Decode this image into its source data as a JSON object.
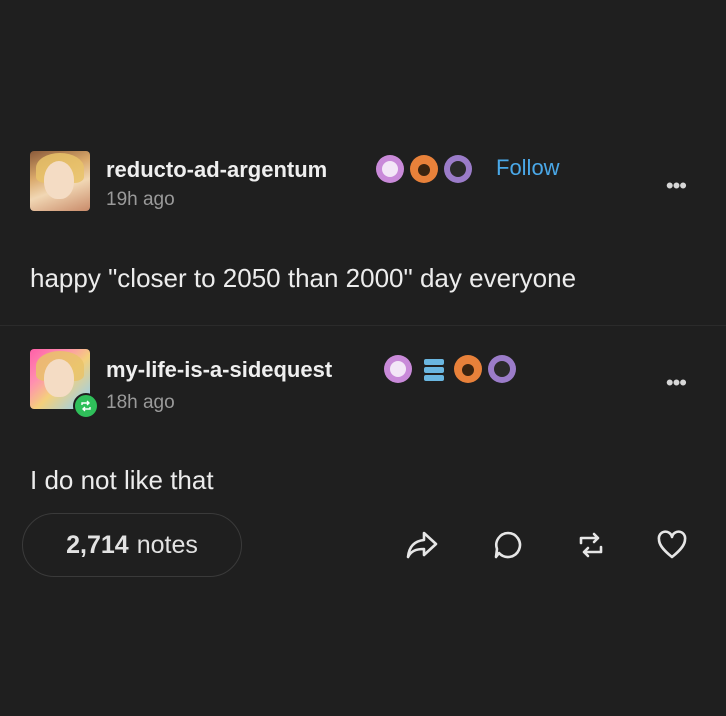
{
  "posts": [
    {
      "username": "reducto-ad-argentum",
      "time": "19h ago",
      "follow_label": "Follow",
      "more_label": "•••",
      "content": "happy \"closer to 2050 than 2000\" day everyone"
    },
    {
      "username": "my-life-is-a-sidequest",
      "time": "18h ago",
      "more_label": "•••",
      "content": "I do not like that"
    }
  ],
  "footer": {
    "notes_count": "2,714",
    "notes_label": "notes"
  },
  "icons": {
    "share": "share-icon",
    "reply": "reply-icon",
    "reblog": "reblog-icon",
    "like": "heart-icon"
  },
  "colors": {
    "background": "#1f1f1f",
    "follow": "#4aa8e8",
    "reblog_badge": "#2fbf5a"
  }
}
